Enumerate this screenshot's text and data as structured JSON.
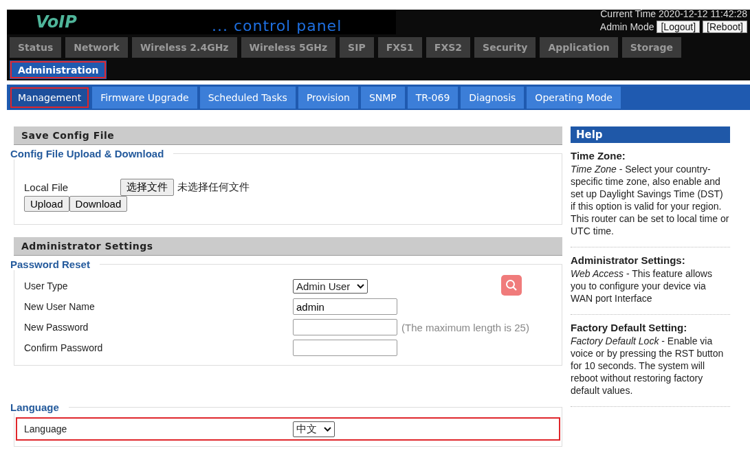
{
  "header": {
    "logo": "VoIP",
    "subtitle": "... control panel",
    "current_time": "Current Time 2020-12-12 11:42:28",
    "mode": "Admin Mode",
    "buttons": [
      "[Logout]",
      "[Reboot]"
    ]
  },
  "tabs": [
    {
      "label": "Status",
      "selected": false,
      "highlighted": false
    },
    {
      "label": "Network",
      "selected": false,
      "highlighted": false
    },
    {
      "label": "Wireless 2.4GHz",
      "selected": false,
      "highlighted": false
    },
    {
      "label": "Wireless 5GHz",
      "selected": false,
      "highlighted": false
    },
    {
      "label": "SIP",
      "selected": false,
      "highlighted": false
    },
    {
      "label": "FXS1",
      "selected": false,
      "highlighted": false
    },
    {
      "label": "FXS2",
      "selected": false,
      "highlighted": false
    },
    {
      "label": "Security",
      "selected": false,
      "highlighted": false
    },
    {
      "label": "Application",
      "selected": false,
      "highlighted": false
    },
    {
      "label": "Storage",
      "selected": false,
      "highlighted": false
    },
    {
      "label": "Administration",
      "selected": true,
      "highlighted": true
    }
  ],
  "subtabs": [
    {
      "label": "Management",
      "selected": true,
      "highlighted": true
    },
    {
      "label": "Firmware Upgrade",
      "selected": false,
      "highlighted": false
    },
    {
      "label": "Scheduled Tasks",
      "selected": false,
      "highlighted": false
    },
    {
      "label": "Provision",
      "selected": false,
      "highlighted": false
    },
    {
      "label": "SNMP",
      "selected": false,
      "highlighted": false
    },
    {
      "label": "TR-069",
      "selected": false,
      "highlighted": false
    },
    {
      "label": "Diagnosis",
      "selected": false,
      "highlighted": false
    },
    {
      "label": "Operating Mode",
      "selected": false,
      "highlighted": false
    }
  ],
  "sections": [
    {
      "title": "Save Config File",
      "groups": [
        {
          "legend": "Config File Upload & Download",
          "rows": [
            {
              "kind": "file",
              "label": "Local File",
              "button": "选择文件",
              "status": "未选择任何文件",
              "highlighted": false
            },
            {
              "kind": "buttons",
              "buttons": [
                "Upload",
                "Download"
              ],
              "highlighted": false
            }
          ]
        }
      ]
    },
    {
      "title": "Administrator Settings",
      "groups": [
        {
          "legend": "Password Reset",
          "rows": [
            {
              "kind": "select",
              "label": "User Type",
              "value": "Admin User",
              "highlighted": false
            },
            {
              "kind": "input",
              "label": "New User Name",
              "value": "admin",
              "highlighted": false
            },
            {
              "kind": "input",
              "label": "New Password",
              "value": "",
              "hint": "(The maximum length is 25)",
              "highlighted": false
            },
            {
              "kind": "input",
              "label": "Confirm Password",
              "value": "",
              "highlighted": false
            }
          ]
        },
        {
          "legend": "Language",
          "rows": [
            {
              "kind": "select",
              "label": "Language",
              "value": "中文",
              "highlighted": true
            }
          ]
        }
      ]
    }
  ],
  "help": {
    "title": "Help",
    "items": [
      {
        "heading": "Time Zone:",
        "text": "*Time Zone* - Select your country-specific time zone, also enable and set up Daylight Savings Time (DST) if this option is valid for your region. This router can be set to local time or UTC time."
      },
      {
        "heading": "Administrator Settings:",
        "text": "*Web Access* - This feature allows you to configure your device via WAN port Interface"
      },
      {
        "heading": "Factory Default Setting:",
        "text": "*Factory Default Lock* - Enable via voice or by pressing the RST button for 10 seconds. The system will reboot without restoring factory default values."
      }
    ]
  }
}
